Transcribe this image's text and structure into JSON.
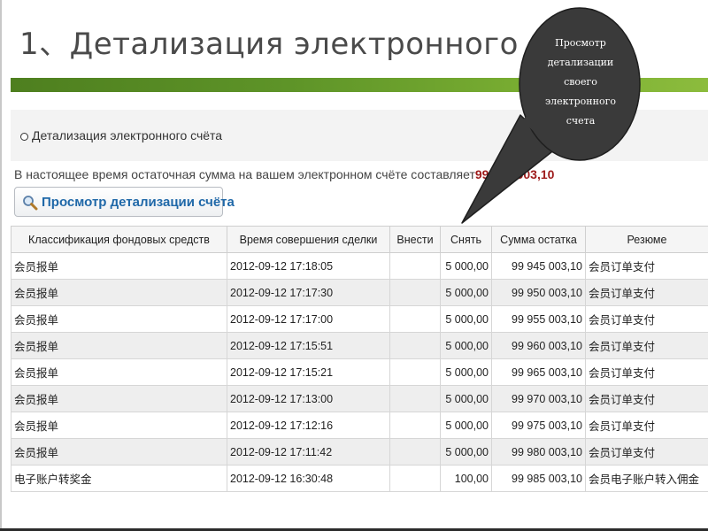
{
  "slide": {
    "title": "1、Детализация электронного счёта"
  },
  "callout": {
    "lines": [
      "Просмотр",
      "детализации",
      "своего",
      "электронного",
      "счета"
    ]
  },
  "section": {
    "title": "Детализация электронного счёта"
  },
  "balance": {
    "prefix": "В настоящее время остаточная сумма на вашем электронном счёте составляет",
    "amount": "99 945 003,10"
  },
  "view_button": {
    "label": "Просмотр детализации счёта",
    "icon": "magnifier-icon"
  },
  "table": {
    "headers": [
      "Классификация фондовых средств",
      "Время совершения сделки",
      "Внести",
      "Снять",
      "Сумма остатка",
      "Резюме"
    ],
    "rows": [
      [
        "会员报单",
        "2012-09-12 17:18:05",
        "",
        "5 000,00",
        "99 945 003,10",
        "会员订单支付"
      ],
      [
        "会员报单",
        "2012-09-12 17:17:30",
        "",
        "5 000,00",
        "99 950 003,10",
        "会员订单支付"
      ],
      [
        "会员报单",
        "2012-09-12 17:17:00",
        "",
        "5 000,00",
        "99 955 003,10",
        "会员订单支付"
      ],
      [
        "会员报单",
        "2012-09-12 17:15:51",
        "",
        "5 000,00",
        "99 960 003,10",
        "会员订单支付"
      ],
      [
        "会员报单",
        "2012-09-12 17:15:21",
        "",
        "5 000,00",
        "99 965 003,10",
        "会员订单支付"
      ],
      [
        "会员报单",
        "2012-09-12 17:13:00",
        "",
        "5 000,00",
        "99 970 003,10",
        "会员订单支付"
      ],
      [
        "会员报单",
        "2012-09-12 17:12:16",
        "",
        "5 000,00",
        "99 975 003,10",
        "会员订单支付"
      ],
      [
        "会员报单",
        "2012-09-12 17:11:42",
        "",
        "5 000,00",
        "99 980 003,10",
        "会员订单支付"
      ],
      [
        "电子账户转奖金",
        "2012-09-12 16:30:48",
        "",
        "100,00",
        "99 985 003,10",
        "会员电子账户转入佣金"
      ]
    ]
  },
  "colors": {
    "accent_green": "#5e9428",
    "balance_red": "#9e1b1b",
    "link_blue": "#1f68a8",
    "callout_fill": "#3a3a3a"
  }
}
